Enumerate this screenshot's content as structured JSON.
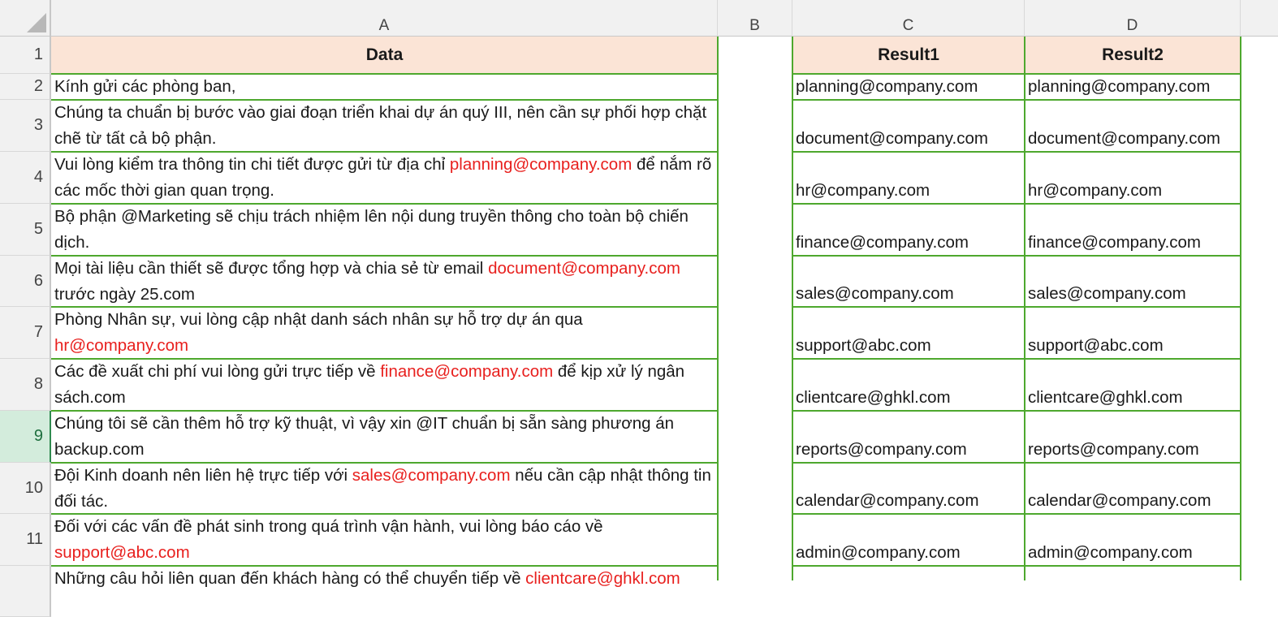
{
  "columns": [
    "A",
    "B",
    "C",
    "D"
  ],
  "rows": [
    "1",
    "2",
    "3",
    "4",
    "5",
    "6",
    "7",
    "8",
    "9",
    "10",
    "11"
  ],
  "selected_row": "9",
  "headers": {
    "data": "Data",
    "result1": "Result1",
    "result2": "Result2"
  },
  "data_rows": [
    {
      "segments": [
        {
          "t": "Kính gửi các phòng ban,",
          "red": false
        }
      ]
    },
    {
      "segments": [
        {
          "t": "Chúng ta chuẩn bị bước vào giai đoạn triển khai dự án quý III, nên cần sự phối hợp chặt chẽ từ tất cả bộ phận.",
          "red": false
        }
      ]
    },
    {
      "segments": [
        {
          "t": "Vui lòng kiểm tra thông tin chi tiết được gửi từ địa chỉ ",
          "red": false
        },
        {
          "t": "planning@company.com",
          "red": true
        },
        {
          "t": " để nắm rõ các mốc thời gian quan trọng.",
          "red": false
        }
      ]
    },
    {
      "segments": [
        {
          "t": "Bộ phận @Marketing sẽ chịu trách nhiệm lên nội dung truyền thông cho toàn bộ chiến dịch.",
          "red": false
        }
      ]
    },
    {
      "segments": [
        {
          "t": "Mọi tài liệu cần thiết sẽ được tổng hợp và chia sẻ từ email ",
          "red": false
        },
        {
          "t": "document@company.com",
          "red": true
        },
        {
          "t": " trước ngày 25.com",
          "red": false
        }
      ]
    },
    {
      "segments": [
        {
          "t": "Phòng Nhân sự, vui lòng cập nhật danh sách nhân sự hỗ trợ dự án qua ",
          "red": false
        },
        {
          "t": "hr@company.com",
          "red": true
        }
      ]
    },
    {
      "segments": [
        {
          "t": "Các đề xuất chi phí vui lòng gửi trực tiếp về ",
          "red": false
        },
        {
          "t": "finance@company.com",
          "red": true
        },
        {
          "t": " để kịp xử lý ngân sách.com",
          "red": false
        }
      ]
    },
    {
      "segments": [
        {
          "t": "Chúng tôi sẽ cần thêm hỗ trợ kỹ thuật, vì vậy xin @IT chuẩn bị sẵn sàng phương án backup.com",
          "red": false
        }
      ]
    },
    {
      "segments": [
        {
          "t": "Đội Kinh doanh nên liên hệ trực tiếp với ",
          "red": false
        },
        {
          "t": "sales@company.com",
          "red": true
        },
        {
          "t": " nếu cần cập nhật thông tin đối tác.",
          "red": false
        }
      ]
    },
    {
      "segments": [
        {
          "t": "Đối với các vấn đề phát sinh trong quá trình vận hành, vui lòng báo cáo về ",
          "red": false
        },
        {
          "t": "support@abc.com",
          "red": true
        }
      ]
    },
    {
      "segments": [
        {
          "t": "Những câu hỏi liên quan đến khách hàng có thể chuyển tiếp về ",
          "red": false
        },
        {
          "t": "clientcare@ghkl.com",
          "red": true
        }
      ]
    }
  ],
  "result1": [
    "planning@company.com",
    "document@company.com",
    "hr@company.com",
    "finance@company.com",
    "sales@company.com",
    "support@abc.com",
    "clientcare@ghkl.com",
    "reports@company.com",
    "calendar@company.com",
    "admin@company.com"
  ],
  "result2": [
    "planning@company.com",
    "document@company.com",
    "hr@company.com",
    "finance@company.com",
    "sales@company.com",
    "support@abc.com",
    "clientcare@ghkl.com",
    "reports@company.com",
    "calendar@company.com",
    "admin@company.com"
  ],
  "colors": {
    "header_fill": "#fbe4d6",
    "gridline": "#4ea82e",
    "email_text": "#e8201e",
    "selected_row_head": "#d3ecdc"
  }
}
